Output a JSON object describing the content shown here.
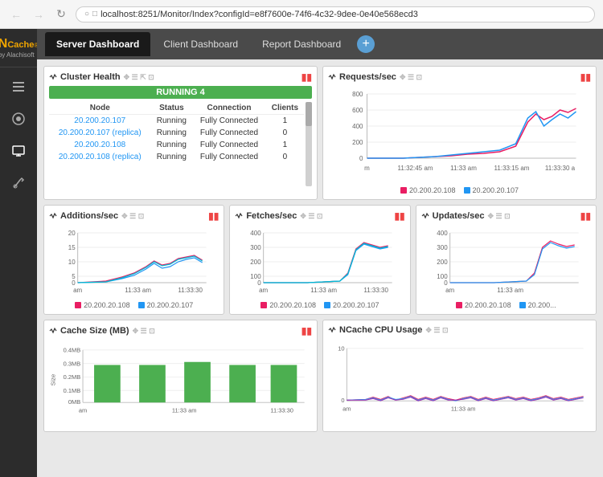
{
  "browser": {
    "back_disabled": true,
    "forward_disabled": true,
    "url": "localhost:8251/Monitor/Index?configId=e8f7600e-74f6-4c32-9dee-0e40e568ecd3"
  },
  "logo": {
    "n": "N",
    "cache": "Cache",
    "by": "by Alachisoft"
  },
  "nav": {
    "tabs": [
      {
        "label": "Server Dashboard",
        "active": true
      },
      {
        "label": "Client Dashboard",
        "active": false
      },
      {
        "label": "Report Dashboard",
        "active": false
      }
    ],
    "add_label": "+"
  },
  "cluster_health": {
    "title": "Cluster Health",
    "status": "RUNNING 4",
    "columns": [
      "Node",
      "Status",
      "Connection",
      "Clients"
    ],
    "rows": [
      {
        "node": "20.200.20.107",
        "status": "Running",
        "connection": "Fully Connected",
        "clients": "1"
      },
      {
        "node": "20.200.20.107 (replica)",
        "status": "Running",
        "connection": "Fully Connected",
        "clients": "0"
      },
      {
        "node": "20.200.20.108",
        "status": "Running",
        "connection": "Fully Connected",
        "clients": "1"
      },
      {
        "node": "20.200.20.108 (replica)",
        "status": "Running",
        "connection": "Fully Connected",
        "clients": "0"
      }
    ]
  },
  "requests_sec": {
    "title": "Requests/sec",
    "y_labels": [
      "800",
      "600",
      "400",
      "200",
      "0"
    ],
    "x_labels": [
      "m",
      "11:32:45 am",
      "11:33 am",
      "11:33:15 am",
      "11:33:30 a"
    ],
    "legend": [
      {
        "label": "20.200.20.108",
        "color": "#e91e63"
      },
      {
        "label": "20.200.20.107",
        "color": "#2196F3"
      }
    ]
  },
  "additions_sec": {
    "title": "Additions/sec",
    "y_labels": [
      "20",
      "15",
      "10",
      "5",
      "0"
    ],
    "x_labels": [
      "am",
      "11:33 am",
      "11:33:30"
    ],
    "legend": [
      {
        "label": "20.200.20.108",
        "color": "#e91e63"
      },
      {
        "label": "20.200.20.107",
        "color": "#2196F3"
      }
    ]
  },
  "fetches_sec": {
    "title": "Fetches/sec",
    "y_labels": [
      "400",
      "300",
      "200",
      "100",
      "0"
    ],
    "x_labels": [
      "am",
      "11:33 am",
      "11:33:30"
    ],
    "legend": [
      {
        "label": "20.200.20.108",
        "color": "#e91e63"
      },
      {
        "label": "20.200.20.107",
        "color": "#2196F3"
      }
    ]
  },
  "updates_sec": {
    "title": "Updates/sec",
    "y_labels": [
      "400",
      "300",
      "200",
      "100",
      "0"
    ],
    "x_labels": [
      "am",
      "11:33 am"
    ],
    "legend": [
      {
        "label": "20.200.20.108",
        "color": "#e91e63"
      },
      {
        "label": "20.200...",
        "color": "#2196F3"
      }
    ]
  },
  "cache_size": {
    "title": "Cache Size (MB)",
    "y_labels": [
      "0.4MB",
      "0.3MB",
      "0.2MB",
      "0.1MB",
      "0MB"
    ],
    "x_labels": [
      "am",
      "11:33 am",
      "11:33:30"
    ],
    "size_label": "Size"
  },
  "ncache_cpu": {
    "title": "NCache CPU Usage",
    "y_labels": [
      "10"
    ],
    "x_labels": [
      "am",
      "11:33 am"
    ]
  }
}
